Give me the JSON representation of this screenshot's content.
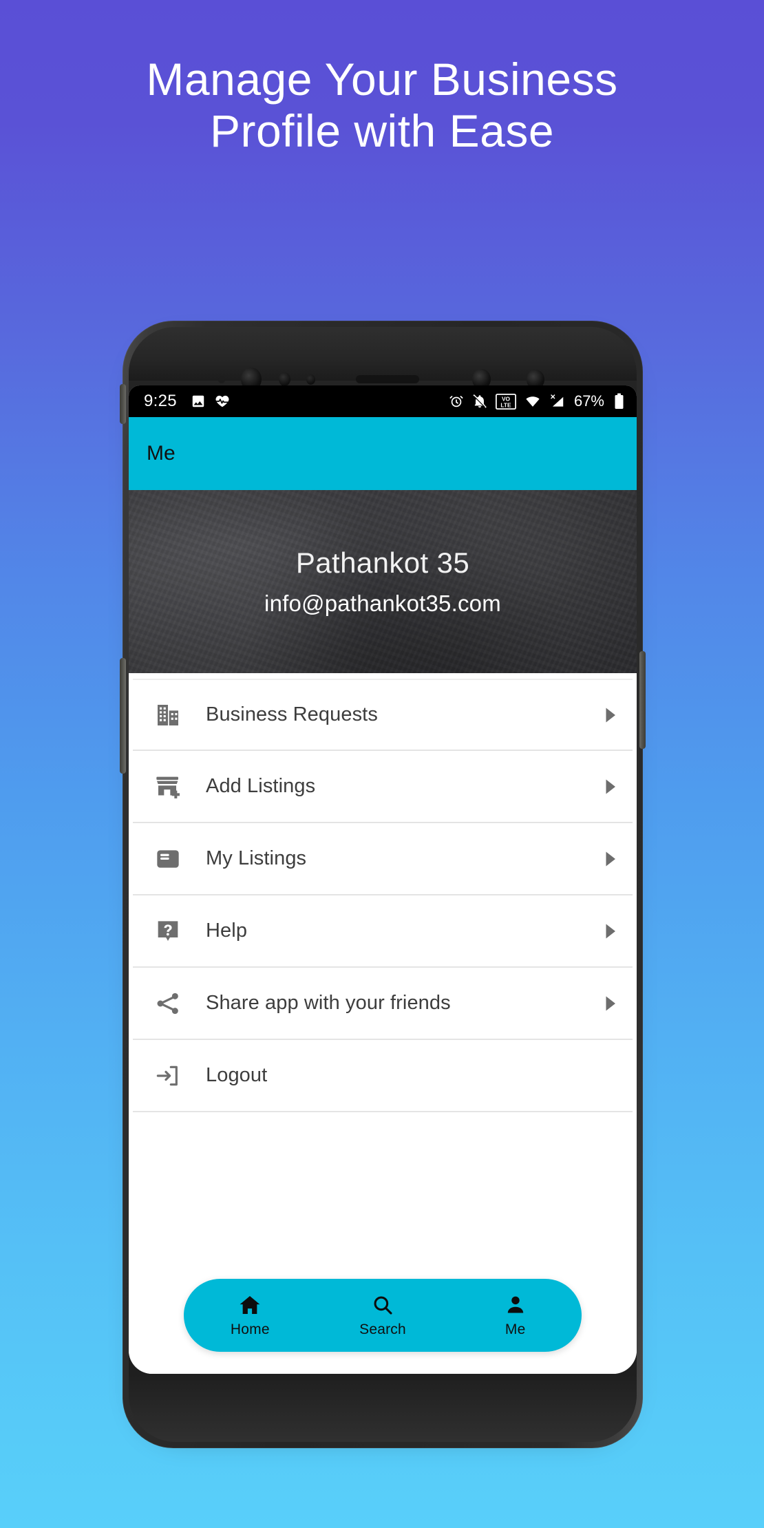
{
  "promo": {
    "headline_line1": "Manage Your Business",
    "headline_line2": "Profile with Ease"
  },
  "colors": {
    "accent_cyan": "#00b9d7",
    "bg_top": "#5a4fd6",
    "bg_bottom": "#58cffa",
    "header_dark": "#333336",
    "icon_grey": "#6e6e6e"
  },
  "statusbar": {
    "time": "9:25",
    "battery_percent": "67%",
    "left_icons": [
      "image-icon",
      "heart-pulse-icon"
    ],
    "right_icons": [
      "alarm-icon",
      "bell-off-icon",
      "volte-icon",
      "wifi-icon",
      "signal-no-sim-icon",
      "battery-icon"
    ],
    "volte_top": "VO",
    "volte_bottom": "LTE"
  },
  "appbar": {
    "title": "Me"
  },
  "profile": {
    "name": "Pathankot 35",
    "email": "info@pathankot35.com"
  },
  "menu": {
    "items": [
      {
        "label": "Business Requests",
        "icon": "building-icon",
        "has_arrow": true
      },
      {
        "label": "Add Listings",
        "icon": "store-add-icon",
        "has_arrow": true
      },
      {
        "label": "My Listings",
        "icon": "listings-icon",
        "has_arrow": true
      },
      {
        "label": "Help",
        "icon": "help-icon",
        "has_arrow": true
      },
      {
        "label": "Share app with your friends",
        "icon": "share-icon",
        "has_arrow": true
      },
      {
        "label": "Logout",
        "icon": "logout-icon",
        "has_arrow": false
      }
    ]
  },
  "bottom_nav": {
    "items": [
      {
        "label": "Home",
        "icon": "home-icon"
      },
      {
        "label": "Search",
        "icon": "search-icon"
      },
      {
        "label": "Me",
        "icon": "person-icon"
      }
    ]
  }
}
